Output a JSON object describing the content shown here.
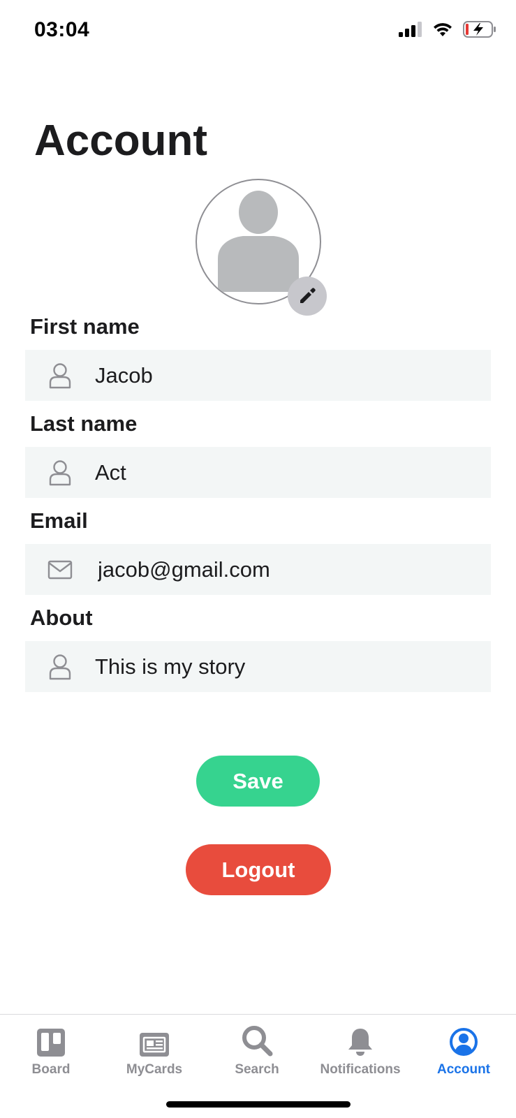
{
  "status_bar": {
    "time": "03:04",
    "icons": [
      "cellular-signal-icon",
      "wifi-icon",
      "battery-charging-icon"
    ]
  },
  "page": {
    "title": "Account"
  },
  "avatar": {
    "icon": "person-silhouette-icon",
    "edit_icon": "pencil-icon"
  },
  "form": {
    "first_name": {
      "label": "First name",
      "value": "Jacob",
      "icon": "person-icon"
    },
    "last_name": {
      "label": "Last name",
      "value": "Act",
      "icon": "person-icon"
    },
    "email": {
      "label": "Email",
      "value": "jacob@gmail.com",
      "icon": "envelope-icon"
    },
    "about": {
      "label": "About",
      "value": "This is my story",
      "icon": "person-icon"
    }
  },
  "actions": {
    "save_label": "Save",
    "logout_label": "Logout"
  },
  "colors": {
    "save": "#36d38f",
    "logout": "#e84c3d",
    "tab_active": "#1a73e8",
    "tab_inactive": "#8e8e93",
    "field_bg": "#f3f6f6"
  },
  "tabs": [
    {
      "label": "Board",
      "icon": "board-icon",
      "active": false
    },
    {
      "label": "MyCards",
      "icon": "cards-icon",
      "active": false
    },
    {
      "label": "Search",
      "icon": "search-icon",
      "active": false
    },
    {
      "label": "Notifications",
      "icon": "bell-icon",
      "active": false
    },
    {
      "label": "Account",
      "icon": "account-circle-icon",
      "active": true
    }
  ]
}
